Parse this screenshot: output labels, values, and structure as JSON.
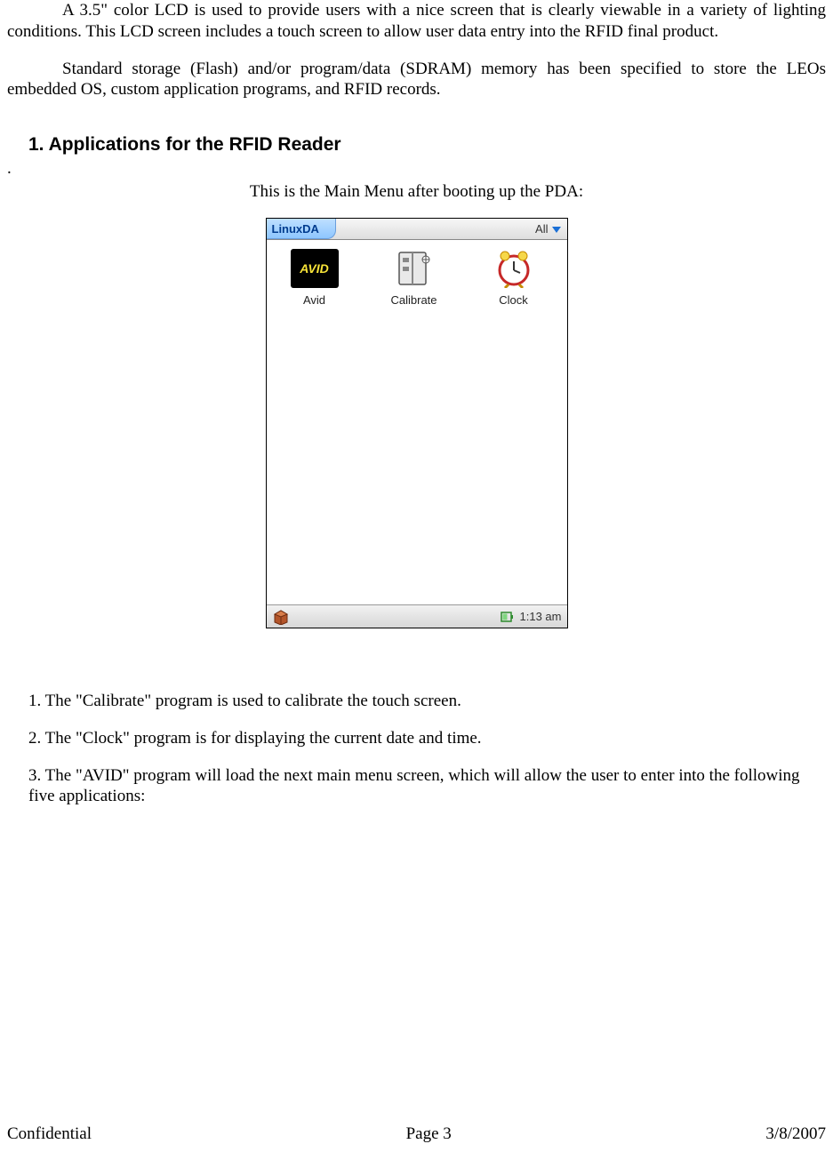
{
  "paragraphs": {
    "p1": "A 3.5\" color LCD is used to provide users with a nice screen that is clearly viewable in a variety of lighting conditions. This LCD screen includes a touch screen to allow user data entry into the RFID final product.",
    "p2": "Standard storage (Flash) and/or program/data (SDRAM) memory has been specified to store the LEOs embedded OS, custom application programs, and RFID records."
  },
  "heading": "1.  Applications for the RFID Reader",
  "dot": ".",
  "caption": "This is the Main Menu after booting up the PDA:",
  "pda": {
    "title": "LinuxDA",
    "filter": "All",
    "apps": [
      {
        "label": "Avid",
        "icon_text": "AVID"
      },
      {
        "label": "Calibrate"
      },
      {
        "label": "Clock"
      }
    ],
    "time": "1:13 am"
  },
  "list": {
    "i1": "1. The \"Calibrate\" program is used to calibrate the touch screen.",
    "i2": "2. The \"Clock\" program is for displaying the current date and time.",
    "i3": "3. The \"AVID\" program will load the next main menu screen,  which will allow the user to enter into the following five applications:"
  },
  "footer": {
    "left": "Confidential",
    "center": "Page 3",
    "right": "3/8/2007"
  }
}
